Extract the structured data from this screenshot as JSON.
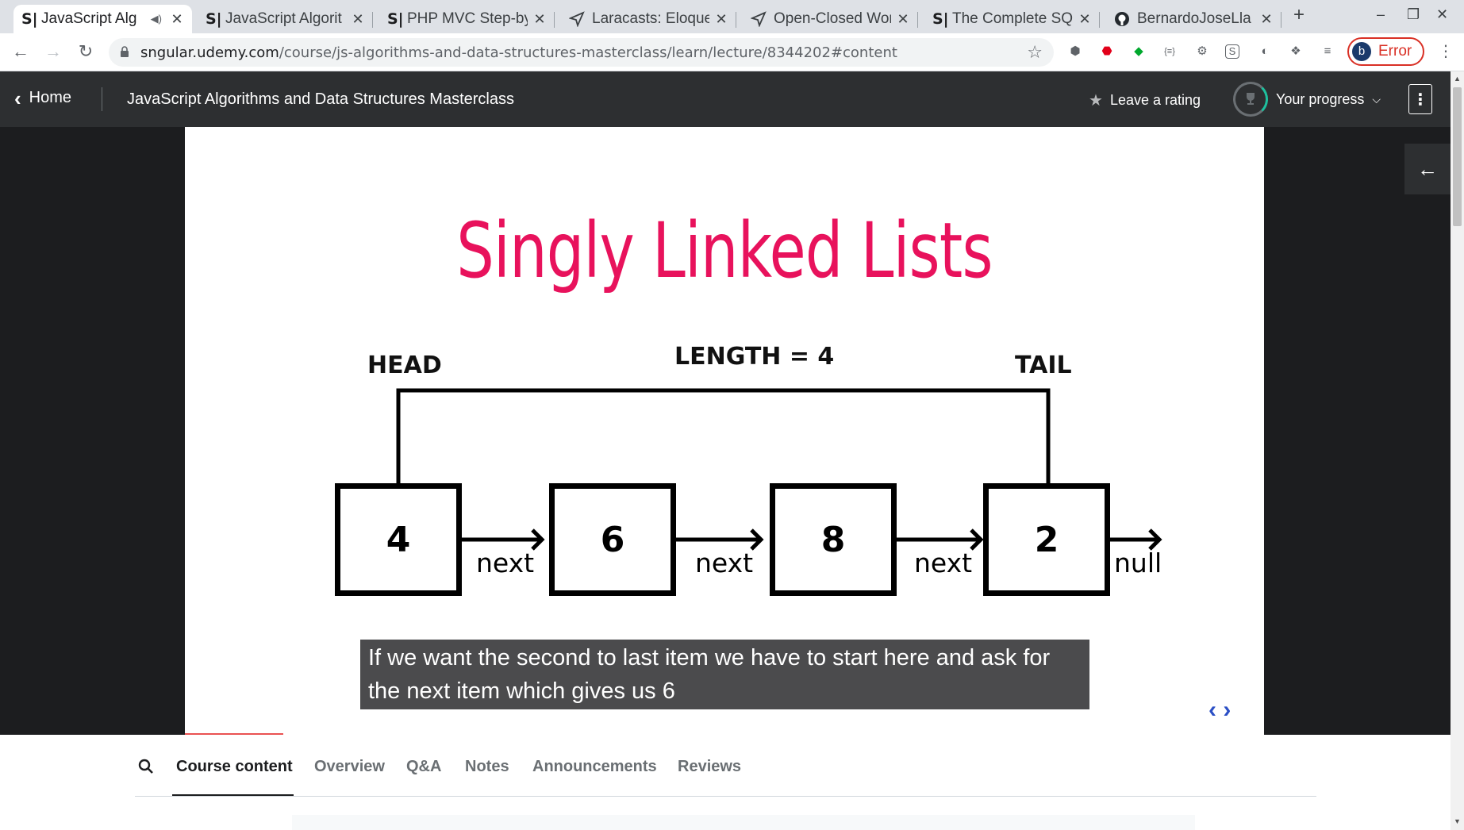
{
  "browser": {
    "tabs": [
      {
        "favicon": "S|",
        "title": "JavaScript Alg",
        "audio": "speaker-icon",
        "active": true
      },
      {
        "favicon": "S|",
        "title": "JavaScript Algorit",
        "active": false
      },
      {
        "favicon": "S|",
        "title": "PHP MVC Step-by",
        "active": false
      },
      {
        "favicon": "laracasts-icon",
        "title": "Laracasts: Eloque",
        "active": false
      },
      {
        "favicon": "laracasts-icon",
        "title": "Open-Closed Wor",
        "active": false
      },
      {
        "favicon": "S|",
        "title": "The Complete SQ",
        "active": false
      },
      {
        "favicon": "github-icon",
        "title": "BernardoJoseLla",
        "active": false
      }
    ],
    "close_glyph": "✕",
    "new_tab_glyph": "+",
    "url": {
      "host": "sngular.udemy.com",
      "path": "/course/js-algorithms-and-data-structures-masterclass/learn/lecture/8344202#content"
    },
    "profile": {
      "initial": "b",
      "status": "Error"
    }
  },
  "header": {
    "home_label": "Home",
    "course_title": "JavaScript Algorithms and Data Structures Masterclass",
    "rating_label": "Leave a rating",
    "progress_label": "Your progress"
  },
  "slide": {
    "title": "Singly Linked Lists",
    "head_label": "HEAD",
    "length_label": "LENGTH = 4",
    "tail_label": "TAIL",
    "nodes": [
      "4",
      "6",
      "8",
      "2"
    ],
    "pointer_label": "next",
    "null_label": "null",
    "caption": "If we want the second to last item we have to start here and ask for the next item which gives us 6"
  },
  "lower_tabs": {
    "items": [
      "Course content",
      "Overview",
      "Q&A",
      "Notes",
      "Announcements",
      "Reviews"
    ],
    "active": "Course content"
  },
  "colors": {
    "title_pink": "#e8125c",
    "header_bg": "#2d2f31",
    "progress_green": "#1ec09e",
    "error_red": "#d93025"
  }
}
